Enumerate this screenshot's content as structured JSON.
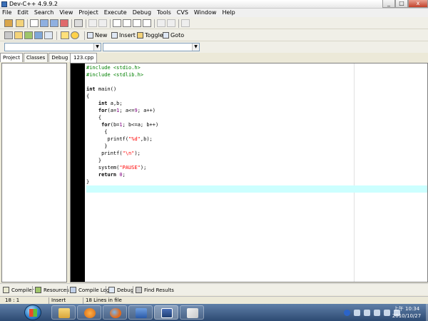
{
  "window": {
    "title": "Dev-C++ 4.9.9.2",
    "controls": {
      "minimize": "_",
      "maximize": "□",
      "close": "x"
    }
  },
  "menu": [
    "File",
    "Edit",
    "Search",
    "View",
    "Project",
    "Execute",
    "Debug",
    "Tools",
    "CVS",
    "Window",
    "Help"
  ],
  "toolbar2": {
    "new_label": "New",
    "insert_label": "Insert",
    "toggle_label": "Toggle",
    "goto_label": "Goto"
  },
  "left_tabs": [
    "Project",
    "Classes",
    "Debug"
  ],
  "file_tab": "123.cpp",
  "code": [
    "#include <stdio.h>",
    "#include <stdlib.h>",
    "",
    "int main()",
    "{",
    "    int a,b;",
    "    for(a=1; a<=9; a++)",
    "    {",
    "     for(b=1; b<=a; b++)",
    "      {",
    "       printf(\"%d\",b);",
    "      }",
    "     printf(\"\\n\");",
    "    }",
    "    system(\"PAUSE\");",
    "    return 0;",
    "}",
    ""
  ],
  "bottom_tabs": [
    "Compiler",
    "Resources",
    "Compile Log",
    "Debug",
    "Find Results"
  ],
  "status": {
    "position": "18 : 1",
    "mode": "Insert",
    "lines": "18 Lines in file"
  },
  "clock": {
    "time": "上午 10:34",
    "date": "2010/10/27"
  }
}
